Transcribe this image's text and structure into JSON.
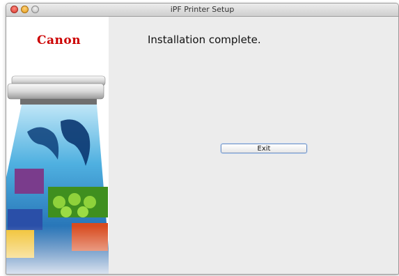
{
  "window": {
    "title": "iPF Printer Setup"
  },
  "sidebar": {
    "brand": "Canon",
    "illustration": "printer-with-printout-illustration"
  },
  "main": {
    "heading": "Installation complete.",
    "exit_button_label": "Exit"
  },
  "colors": {
    "brand_red": "#cc0000",
    "content_bg": "#ececec",
    "button_focus_border": "#6f8fbf"
  }
}
